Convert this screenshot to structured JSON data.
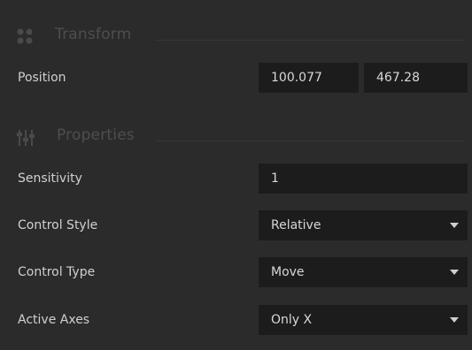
{
  "transform": {
    "title": "Transform",
    "icon": "grid-icon",
    "position_label": "Position",
    "position_x": "100.077",
    "position_y": "467.28"
  },
  "properties": {
    "title": "Properties",
    "icon": "sliders-icon",
    "sensitivity_label": "Sensitivity",
    "sensitivity_value": "1",
    "control_style_label": "Control Style",
    "control_style_value": "Relative",
    "control_type_label": "Control Type",
    "control_type_value": "Move",
    "active_axes_label": "Active Axes",
    "active_axes_value": "Only X"
  },
  "colors": {
    "panel_bg": "#2b2b2b",
    "field_bg": "#1c1c1c",
    "header_text": "#4e4e4e",
    "label_text": "#d0d0d0"
  }
}
